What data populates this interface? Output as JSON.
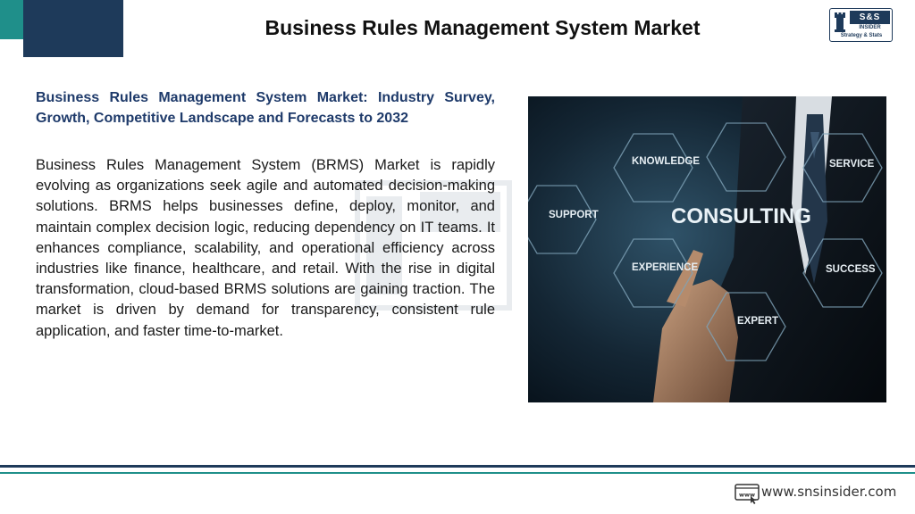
{
  "header": {
    "title": "Business Rules Management System Market"
  },
  "logo": {
    "name": "S&S",
    "sub": "INSIDER",
    "tagline": "Strategy & Stats"
  },
  "article": {
    "headline": "Business Rules Management System Market: Industry Survey, Growth, Competitive Landscape and Forecasts to 2032",
    "body": "Business Rules Management System (BRMS) Market is rapidly evolving as organizations seek agile and automated decision-making solutions. BRMS helps businesses define, deploy, monitor, and maintain complex decision logic, reducing dependency on IT teams. It enhances compliance, scalability, and operational efficiency across industries like finance, healthcare, and retail. With the rise in digital transformation, cloud-based BRMS solutions are gaining traction. The market is driven by demand for transparency, consistent rule application, and faster time-to-market."
  },
  "image": {
    "center": "CONSULTING",
    "labels": {
      "knowledge": "KNOWLEDGE",
      "service": "SERVICE",
      "support": "SUPPORT",
      "experience": "EXPERIENCE",
      "success": "SUCCESS",
      "expert": "EXPERT"
    }
  },
  "footer": {
    "icon_text": "www",
    "url": "www.snsinsider.com"
  },
  "colors": {
    "navy": "#1e3a5a",
    "teal": "#1f8f8a",
    "headline": "#1e3a6a"
  }
}
